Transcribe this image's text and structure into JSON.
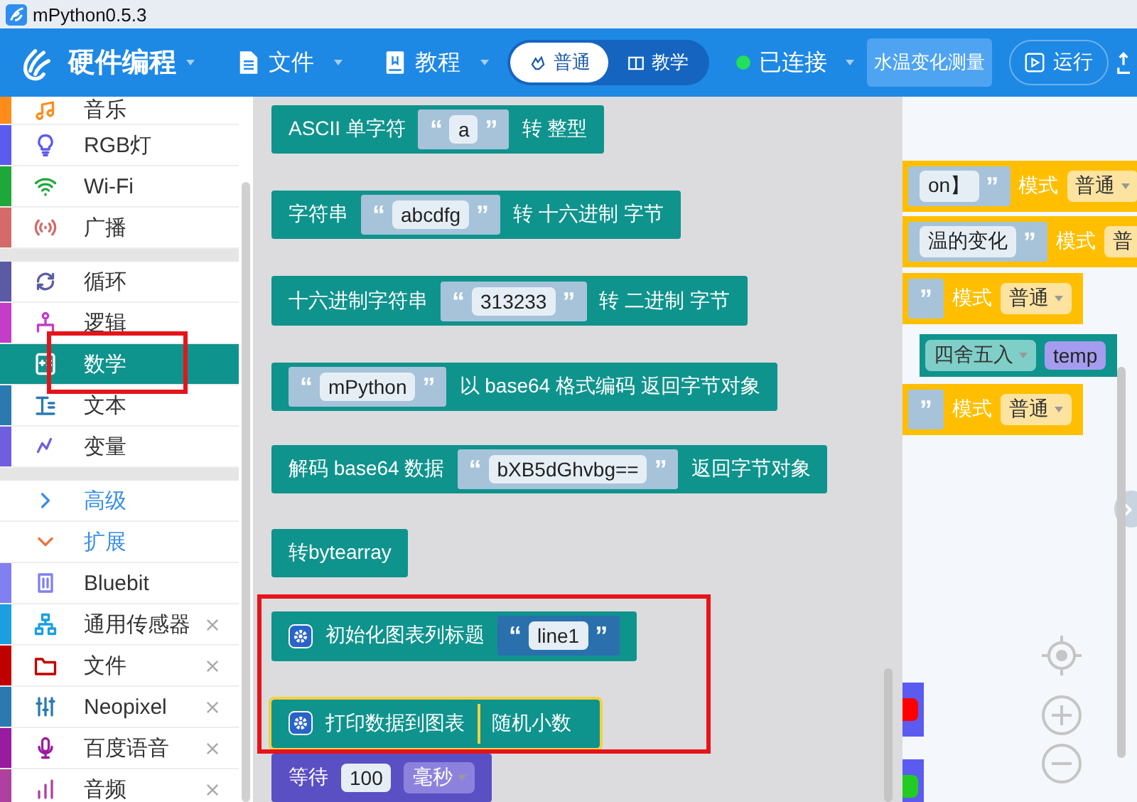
{
  "window": {
    "title": "mPython0.5.3"
  },
  "nav": {
    "brand": "硬件编程",
    "menus": [
      {
        "label": "文件"
      },
      {
        "label": "教程"
      }
    ],
    "mode_toggle": [
      {
        "label": "普通",
        "selected": true
      },
      {
        "label": "教学",
        "selected": false
      }
    ],
    "connection": {
      "label": "已连接",
      "connected": true
    },
    "project": "水温变化测量",
    "run": "运行"
  },
  "sidebar": {
    "groups": [
      [
        {
          "label": "音乐",
          "kind": "category",
          "color": "#ff8c1a",
          "selected": false,
          "closable": false
        },
        {
          "label": "RGB灯",
          "kind": "category",
          "color": "#5b5bf0",
          "selected": false,
          "closable": false
        },
        {
          "label": "Wi-Fi",
          "kind": "category",
          "color": "#1fa83a",
          "selected": false,
          "closable": false
        },
        {
          "label": "广播",
          "kind": "category",
          "color": "#d46a6a",
          "selected": false,
          "closable": false
        }
      ],
      [
        {
          "label": "循环",
          "kind": "category",
          "color": "#5b5ba5",
          "selected": false,
          "closable": false
        },
        {
          "label": "逻辑",
          "kind": "category",
          "color": "#c33dc9",
          "selected": false,
          "closable": false
        },
        {
          "label": "数学",
          "kind": "category",
          "color": "#0f938d",
          "selected": true,
          "closable": false
        },
        {
          "label": "文本",
          "kind": "category",
          "color": "#2a7ab0",
          "selected": false,
          "closable": false
        },
        {
          "label": "变量",
          "kind": "category",
          "color": "#6f5fe0",
          "selected": false,
          "closable": false
        }
      ],
      [
        {
          "label": "高级",
          "kind": "section",
          "selected": false,
          "closable": false
        },
        {
          "label": "扩展",
          "kind": "section",
          "selected": false,
          "closable": false
        },
        {
          "label": "Bluebit",
          "kind": "category",
          "color": "#8080f0",
          "selected": false,
          "closable": false
        },
        {
          "label": "通用传感器",
          "kind": "category",
          "color": "#1a9fe0",
          "selected": false,
          "closable": true
        },
        {
          "label": "文件",
          "kind": "category",
          "color": "#c00000",
          "selected": false,
          "closable": true
        },
        {
          "label": "Neopixel",
          "kind": "category",
          "color": "#2a7ab0",
          "selected": false,
          "closable": true
        },
        {
          "label": "百度语音",
          "kind": "category",
          "color": "#9a1aa0",
          "selected": false,
          "closable": true
        },
        {
          "label": "音频",
          "kind": "category",
          "color": "#b040a0",
          "selected": false,
          "closable": true
        }
      ]
    ]
  },
  "flyout": {
    "blocks": [
      {
        "color": "#0f938d",
        "selected": false,
        "parts": [
          {
            "kind": "text",
            "text": "ASCII 单字符"
          },
          {
            "kind": "string",
            "open": "“",
            "value": "a",
            "close": "”"
          },
          {
            "kind": "text",
            "text": "转 整型"
          }
        ]
      },
      {
        "color": "#0f938d",
        "selected": false,
        "parts": [
          {
            "kind": "text",
            "text": "字符串"
          },
          {
            "kind": "string",
            "open": "“",
            "value": "abcdfg",
            "close": "”"
          },
          {
            "kind": "text",
            "text": "转 十六进制 字节"
          }
        ]
      },
      {
        "color": "#0f938d",
        "selected": false,
        "parts": [
          {
            "kind": "text",
            "text": "十六进制字符串"
          },
          {
            "kind": "string",
            "open": "“",
            "value": "313233",
            "close": "”"
          },
          {
            "kind": "text",
            "text": "转 二进制 字节"
          }
        ]
      },
      {
        "color": "#0f938d",
        "selected": false,
        "parts": [
          {
            "kind": "string",
            "open": "“",
            "value": "mPython",
            "close": "”"
          },
          {
            "kind": "text",
            "text": "以 base64 格式编码 返回字节对象"
          }
        ]
      },
      {
        "color": "#0f938d",
        "selected": false,
        "parts": [
          {
            "kind": "text",
            "text": "解码 base64 数据"
          },
          {
            "kind": "string",
            "open": "“",
            "value": "bXB5dGhvbg==",
            "close": "”"
          },
          {
            "kind": "text",
            "text": "返回字节对象"
          }
        ]
      },
      {
        "color": "#0f938d",
        "selected": false,
        "parts": [
          {
            "kind": "text",
            "text": "转bytearray"
          }
        ]
      },
      {
        "color": "#0f938d",
        "selected": false,
        "parts": [
          {
            "kind": "icon"
          },
          {
            "kind": "text",
            "text": "初始化图表列标题"
          },
          {
            "kind": "string_block",
            "open": "“",
            "value": "line1",
            "close": "”"
          }
        ]
      },
      {
        "color": "#0f938d",
        "selected": true,
        "parts": [
          {
            "kind": "icon"
          },
          {
            "kind": "text",
            "text": "打印数据到图表"
          },
          {
            "kind": "value_block",
            "text": "随机小数"
          }
        ]
      },
      {
        "color": "#5b4fc4",
        "selected": false,
        "parts": [
          {
            "kind": "text",
            "text": "等待"
          },
          {
            "kind": "number",
            "value": "100"
          },
          {
            "kind": "dropdown",
            "value": "毫秒"
          }
        ]
      }
    ]
  },
  "workspace": {
    "rows": [
      {
        "color": "#ffbf00",
        "parts": [
          {
            "kind": "string",
            "value": "on】",
            "close": "”"
          },
          {
            "kind": "text",
            "text": "模式"
          },
          {
            "kind": "dropdown",
            "value": "普通"
          }
        ]
      },
      {
        "color": "#ffbf00",
        "parts": [
          {
            "kind": "string",
            "value": "温的变化",
            "close": "”"
          },
          {
            "kind": "text",
            "text": "模式"
          },
          {
            "kind": "dropdown",
            "value": "普"
          }
        ]
      },
      {
        "color": "#ffbf00",
        "parts": [
          {
            "kind": "string",
            "close": "”"
          },
          {
            "kind": "text",
            "text": "模式"
          },
          {
            "kind": "dropdown",
            "value": "普通"
          }
        ]
      },
      {
        "color": "#0f938d",
        "parts": [
          {
            "kind": "dropdown",
            "value": "四舍五入"
          },
          {
            "kind": "variable",
            "value": "temp"
          }
        ]
      },
      {
        "color": "#ffbf00",
        "parts": [
          {
            "kind": "string",
            "close": "”"
          },
          {
            "kind": "text",
            "text": "模式"
          },
          {
            "kind": "dropdown",
            "value": "普通"
          }
        ]
      }
    ],
    "swatches": [
      {
        "color": "#ff0000"
      },
      {
        "color": "#22cc22"
      }
    ]
  }
}
